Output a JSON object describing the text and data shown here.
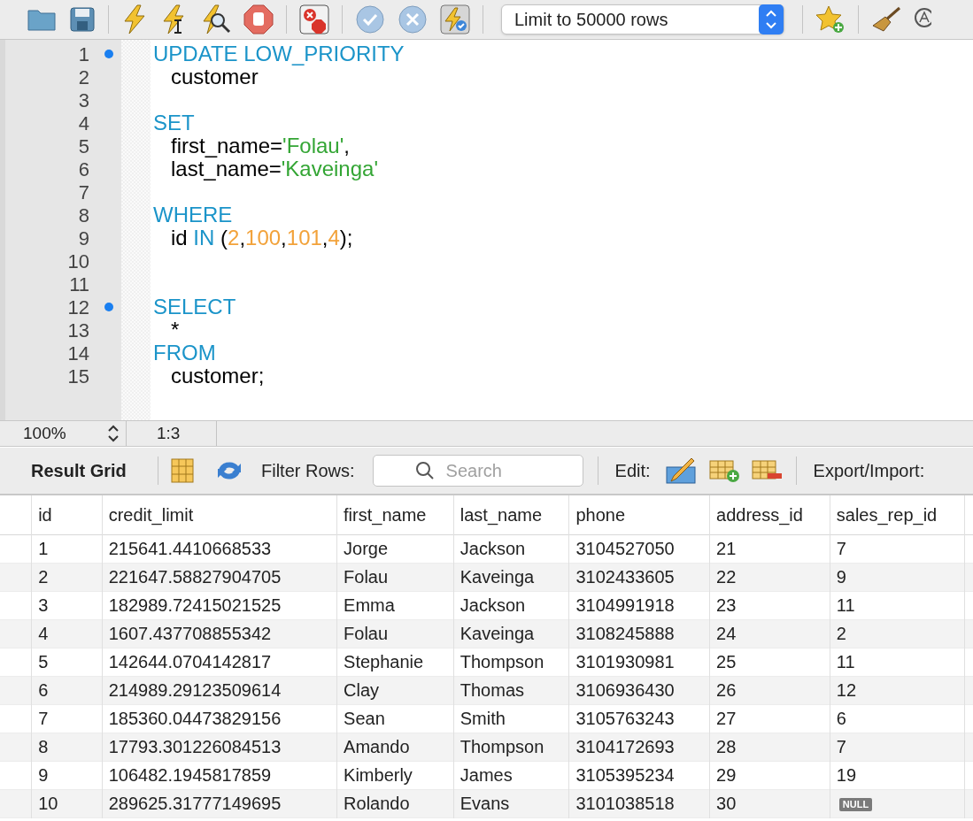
{
  "toolbar": {
    "row_limit": "Limit to 50000 rows"
  },
  "editor": {
    "lines": [
      {
        "number": "1",
        "marker": true,
        "tokens": [
          {
            "kind": "keyword",
            "text": "UPDATE LOW_PRIORITY"
          }
        ]
      },
      {
        "number": "2",
        "marker": false,
        "tokens": [
          {
            "kind": "plain",
            "text": "   customer"
          }
        ]
      },
      {
        "number": "3",
        "marker": false
      },
      {
        "number": "4",
        "marker": false,
        "tokens": [
          {
            "kind": "keyword",
            "text": "SET"
          }
        ]
      },
      {
        "number": "5",
        "marker": false,
        "tokens": [
          {
            "kind": "plain",
            "text": "   first_name="
          },
          {
            "kind": "string",
            "text": "'Folau'"
          },
          {
            "kind": "plain",
            "text": ","
          }
        ]
      },
      {
        "number": "6",
        "marker": false,
        "tokens": [
          {
            "kind": "plain",
            "text": "   last_name="
          },
          {
            "kind": "string",
            "text": "'Kaveinga'"
          }
        ]
      },
      {
        "number": "7",
        "marker": false
      },
      {
        "number": "8",
        "marker": false,
        "tokens": [
          {
            "kind": "keyword",
            "text": "WHERE"
          }
        ]
      },
      {
        "number": "9",
        "marker": false,
        "tokens": [
          {
            "kind": "plain",
            "text": "   id "
          },
          {
            "kind": "keyword",
            "text": "IN"
          },
          {
            "kind": "plain",
            "text": " ("
          },
          {
            "kind": "number",
            "text": "2"
          },
          {
            "kind": "plain",
            "text": ","
          },
          {
            "kind": "number",
            "text": "100"
          },
          {
            "kind": "plain",
            "text": ","
          },
          {
            "kind": "number",
            "text": "101"
          },
          {
            "kind": "plain",
            "text": ","
          },
          {
            "kind": "number",
            "text": "4"
          },
          {
            "kind": "plain",
            "text": ");"
          }
        ]
      },
      {
        "number": "10",
        "marker": false
      },
      {
        "number": "11",
        "marker": false
      },
      {
        "number": "12",
        "marker": true,
        "tokens": [
          {
            "kind": "keyword",
            "text": "SELECT"
          }
        ]
      },
      {
        "number": "13",
        "marker": false,
        "tokens": [
          {
            "kind": "plain",
            "text": "   *"
          }
        ]
      },
      {
        "number": "14",
        "marker": false,
        "tokens": [
          {
            "kind": "keyword",
            "text": "FROM"
          }
        ]
      },
      {
        "number": "15",
        "marker": false,
        "tokens": [
          {
            "kind": "plain",
            "text": "   customer;"
          }
        ]
      }
    ]
  },
  "status_bar": {
    "zoom": "100%",
    "cursor": "1:3"
  },
  "result_toolbar": {
    "title": "Result Grid",
    "filter_label": "Filter Rows:",
    "search_placeholder": "Search",
    "edit_label": "Edit:",
    "export_label": "Export/Import:"
  },
  "table": {
    "columns": [
      "id",
      "credit_limit",
      "first_name",
      "last_name",
      "phone",
      "address_id",
      "sales_rep_id"
    ],
    "rows": [
      {
        "cells": [
          "1",
          "215641.4410668533",
          "Jorge",
          "Jackson",
          "3104527050",
          "21",
          "7"
        ]
      },
      {
        "cells": [
          "2",
          "221647.58827904705",
          "Folau",
          "Kaveinga",
          "3102433605",
          "22",
          "9"
        ]
      },
      {
        "cells": [
          "3",
          "182989.72415021525",
          "Emma",
          "Jackson",
          "3104991918",
          "23",
          "11"
        ]
      },
      {
        "cells": [
          "4",
          "1607.437708855342",
          "Folau",
          "Kaveinga",
          "3108245888",
          "24",
          "2"
        ]
      },
      {
        "cells": [
          "5",
          "142644.0704142817",
          "Stephanie",
          "Thompson",
          "3101930981",
          "25",
          "11"
        ]
      },
      {
        "cells": [
          "6",
          "214989.29123509614",
          "Clay",
          "Thomas",
          "3106936430",
          "26",
          "12"
        ]
      },
      {
        "cells": [
          "7",
          "185360.04473829156",
          "Sean",
          "Smith",
          "3105763243",
          "27",
          "6"
        ]
      },
      {
        "cells": [
          "8",
          "17793.301226084513",
          "Amando",
          "Thompson",
          "3104172693",
          "28",
          "7"
        ]
      },
      {
        "cells": [
          "9",
          "106482.1945817859",
          "Kimberly",
          "James",
          "3105395234",
          "29",
          "19"
        ]
      },
      {
        "cells": [
          "10",
          "289625.31777149695",
          "Rolando",
          "Evans",
          "3101038518",
          "30",
          {
            "kind": "null",
            "text": "NULL"
          }
        ]
      }
    ]
  }
}
